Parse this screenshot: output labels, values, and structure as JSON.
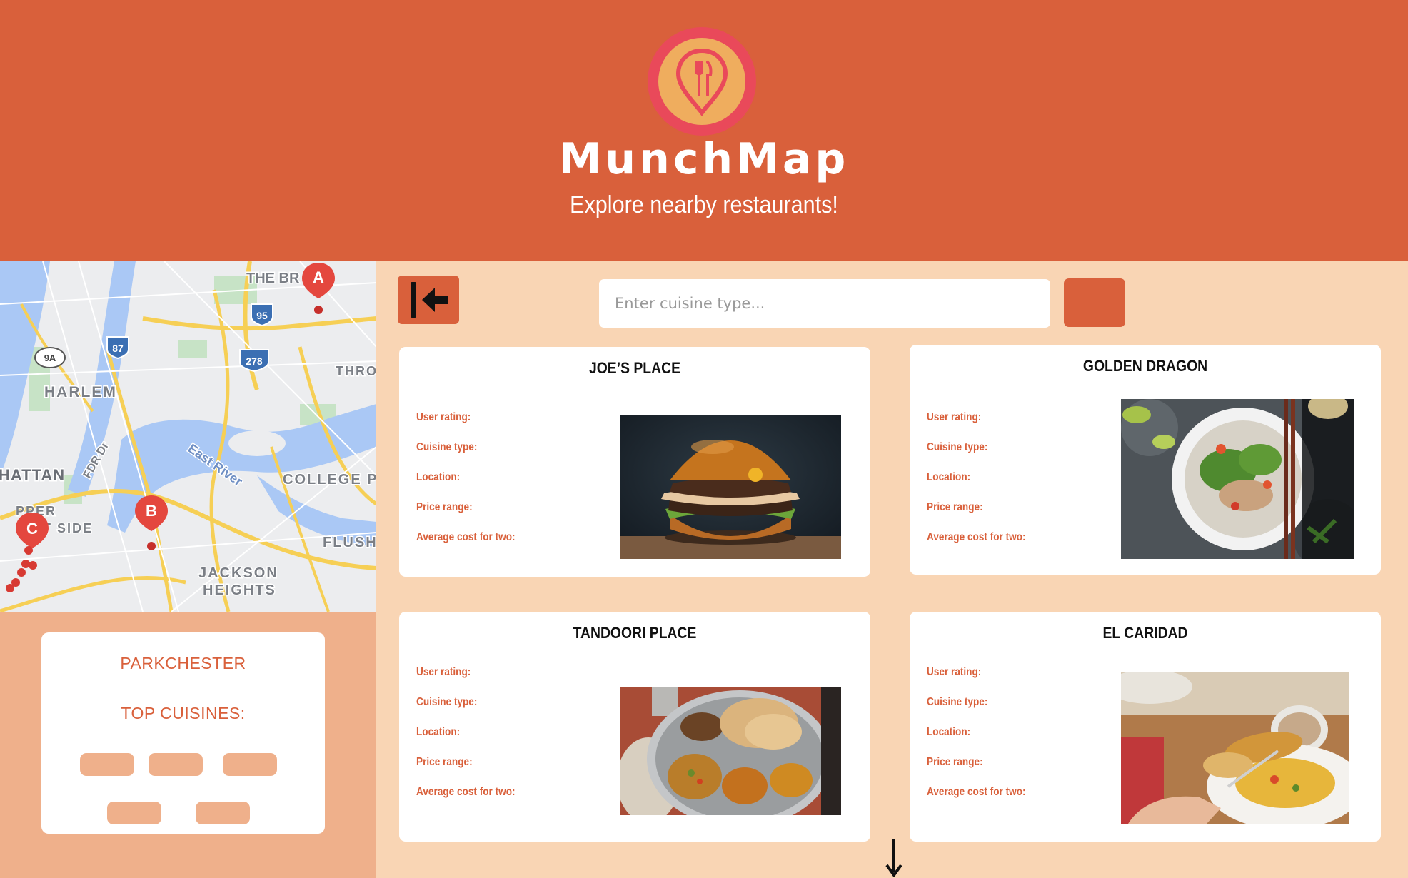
{
  "header": {
    "brand": "MunchMap",
    "tagline": "Explore nearby restaurants!",
    "logo_icon": "location-pin-utensils-icon"
  },
  "sidebar": {
    "map_labels": {
      "the_bronx": "THE BR",
      "harlem": "HARLEM",
      "manhattan": "HATTAN",
      "upper": "PPER",
      "side": "T SIDE",
      "college": "COLLEGE P",
      "flushing": "FLUSH",
      "jackson": "JACKSON",
      "heights": "HEIGHTS",
      "east_river": "East River",
      "fdr": "FDR Dr",
      "throgs": "THRO",
      "shield_95": "95",
      "shield_87": "87",
      "shield_278": "278",
      "shield_9a": "9A",
      "marker_a": "A",
      "marker_b": "B",
      "marker_c": "C"
    },
    "neighborhood": "PARKCHESTER",
    "top_cuisines_label": "TOP CUISINES:"
  },
  "toolbar": {
    "collapse_icon": "collapse-left-icon",
    "search_placeholder": "Enter cuisine type...",
    "search_value": ""
  },
  "field_labels": {
    "rating": "User rating:",
    "cuisine": "Cuisine type:",
    "location": "Location:",
    "price": "Price range:",
    "cost": "Average cost for two:"
  },
  "restaurants": [
    {
      "name": "JOE’S PLACE",
      "image": "burger-photo"
    },
    {
      "name": "GOLDEN DRAGON",
      "image": "noodle-soup-photo"
    },
    {
      "name": "TANDOORI PLACE",
      "image": "thali-photo"
    },
    {
      "name": "EL CARIDAD",
      "image": "breakfast-photo"
    }
  ],
  "colors": {
    "primary": "#d9603b",
    "background": "#f9d5b4",
    "sidebar": "#efb08b",
    "card": "#ffffff",
    "logo_ring": "#e9495a",
    "logo_fill": "#efad5e"
  },
  "scroll_icon": "arrow-down-icon"
}
